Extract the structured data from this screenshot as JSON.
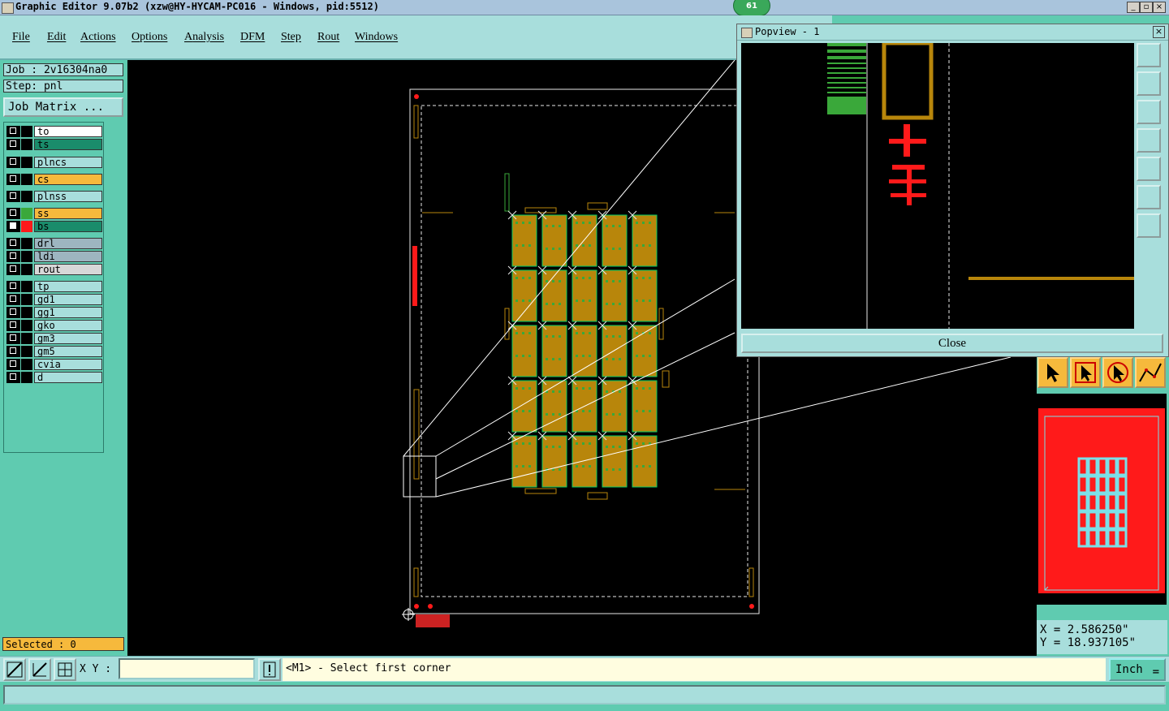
{
  "window": {
    "title": "Graphic Editor 9.07b2 (xzw@HY-HYCAM-PC016 - Windows, pid:5512)",
    "badge": "61",
    "controls": [
      "_",
      "▫",
      "×"
    ]
  },
  "menu": [
    "File",
    "Edit",
    "Actions",
    "Options",
    "Analysis",
    "DFM",
    "Step",
    "Rout",
    "Windows"
  ],
  "job": {
    "job_label": "Job : 2v16304na0",
    "step_label": "Step: pnl",
    "matrix_button": "Job Matrix ..."
  },
  "layers": [
    {
      "name": "to",
      "color": "#ffffff"
    },
    {
      "name": "ts",
      "color": "#1a8c6b"
    },
    {
      "name": "plncs",
      "color": "#a8dedc"
    },
    {
      "name": "cs",
      "color": "#f6b93c"
    },
    {
      "name": "plnss",
      "color": "#a8dedc"
    },
    {
      "name": "ss",
      "color": "#f6b93c",
      "swatch": "#3aa83a"
    },
    {
      "name": "bs",
      "color": "#1a8c6b",
      "swatch": "#ff1a1a",
      "active": true
    },
    {
      "name": "drl",
      "color": "#9db5c0"
    },
    {
      "name": "ldi",
      "color": "#9db5c0"
    },
    {
      "name": "rout",
      "color": "#d8d8d8"
    },
    {
      "name": "tp",
      "color": "#a8dedc"
    },
    {
      "name": "gd1",
      "color": "#a8dedc"
    },
    {
      "name": "gg1",
      "color": "#a8dedc"
    },
    {
      "name": "gko",
      "color": "#a8dedc"
    },
    {
      "name": "gm3",
      "color": "#a8dedc"
    },
    {
      "name": "gm5",
      "color": "#a8dedc"
    },
    {
      "name": "cvia",
      "color": "#a8dedc"
    },
    {
      "name": "d",
      "color": "#a8dedc"
    }
  ],
  "selected_label": "Selected : 0",
  "popview": {
    "title": "Popview - 1",
    "close_label": "Close",
    "tools": [
      "zoom-window-icon",
      "pan-up-icon",
      "pan-down-icon",
      "pan-left-icon",
      "pan-right-icon",
      "fit-icon",
      "center-icon"
    ]
  },
  "coords": {
    "x": "X = 2.586250\"",
    "y": "Y = 18.937105\""
  },
  "bottom": {
    "xy_label": "X Y :",
    "xy_value": "",
    "prompt": "<M1> - Select first corner",
    "unit": "Inch"
  },
  "colors": {
    "panel": "#5fcbb0",
    "light_panel": "#a8dedc",
    "board_fill": "#b8860b",
    "board_outline": "#00cc66",
    "red_layer": "#ff1a1a",
    "orange": "#f6b93c"
  }
}
